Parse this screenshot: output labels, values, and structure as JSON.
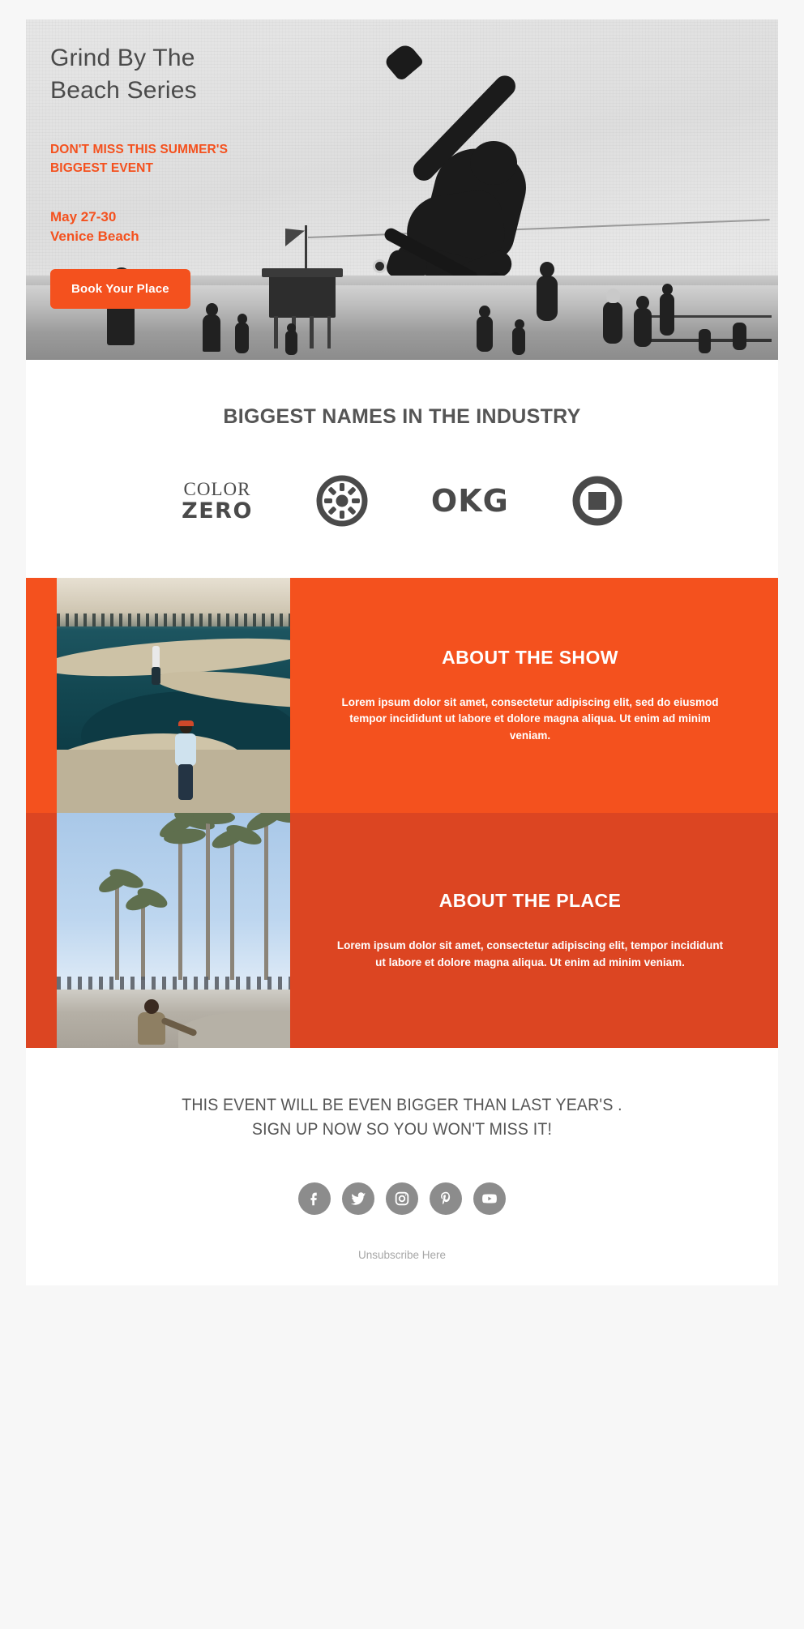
{
  "hero": {
    "title_line1": "Grind By The",
    "title_line2": "Beach Series",
    "kicker_line1": "DON'T MISS THIS SUMMER'S",
    "kicker_line2": "BIGGEST EVENT",
    "date": "May 27-30",
    "location": "Venice Beach",
    "cta_label": "Book Your Place",
    "accent_color": "#F4511E",
    "title_color": "#4A4A4A"
  },
  "brands": {
    "heading": "BIGGEST NAMES IN THE INDUSTRY",
    "logos": [
      {
        "name": "color-zero-logo",
        "top_text": "COLOR",
        "bottom_text": "ZERO"
      },
      {
        "name": "wheel-logo",
        "text": ""
      },
      {
        "name": "okg-logo",
        "text": "OKG"
      },
      {
        "name": "square-ring-logo",
        "text": ""
      }
    ]
  },
  "about_sections": [
    {
      "id": "about-the-show",
      "heading": "ABOUT THE SHOW",
      "body": "Lorem ipsum dolor sit amet, consectetur adipiscing elit, sed do eiusmod tempor incididunt ut labore et dolore magna aliqua. Ut enim ad minim veniam.",
      "image_alt": "skatepark-bowl-photo",
      "bg_color": "#F4511E"
    },
    {
      "id": "about-the-place",
      "heading": "ABOUT THE PLACE",
      "body": "Lorem ipsum dolor sit amet, consectetur adipiscing elit, tempor incididunt ut labore et dolore magna aliqua. Ut enim ad minim veniam.",
      "image_alt": "venice-beach-palms-photo",
      "bg_color": "#DC4522"
    }
  ],
  "footer": {
    "message_line1": "THIS EVENT WILL BE EVEN BIGGER THAN LAST YEAR'S .",
    "message_line2": "SIGN UP NOW SO YOU WON'T MISS IT!",
    "social": [
      {
        "name": "facebook-icon",
        "label": "Facebook"
      },
      {
        "name": "twitter-icon",
        "label": "Twitter"
      },
      {
        "name": "instagram-icon",
        "label": "Instagram"
      },
      {
        "name": "pinterest-icon",
        "label": "Pinterest"
      },
      {
        "name": "youtube-icon",
        "label": "YouTube"
      }
    ],
    "social_color": "#8C8C8C",
    "unsubscribe_label": "Unsubscribe Here"
  }
}
